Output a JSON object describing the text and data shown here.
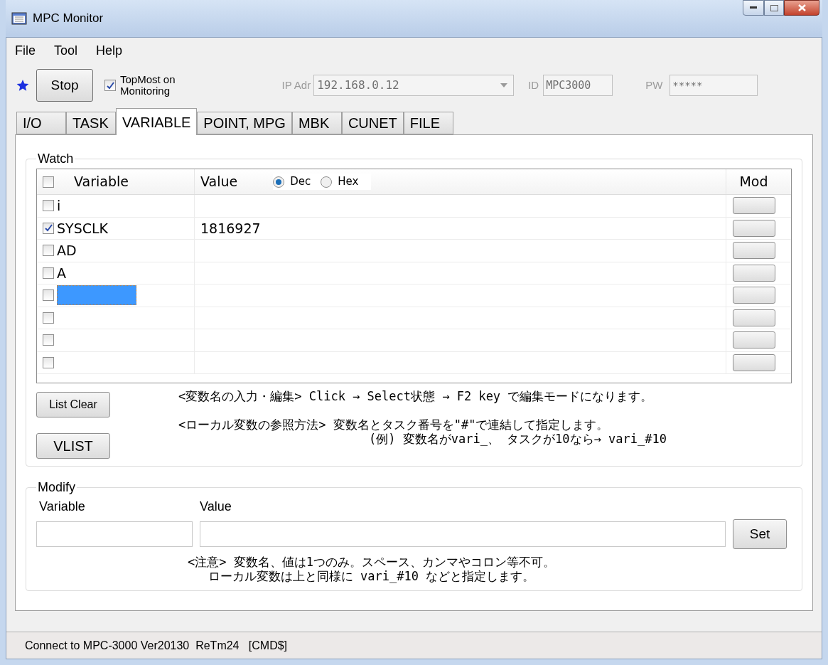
{
  "window": {
    "title": "MPC Monitor"
  },
  "menu": [
    "File",
    "Tool",
    "Help"
  ],
  "toolbar": {
    "stop_button": "Stop",
    "topmost": {
      "label_1": "TopMost on",
      "label_2": "Monitoring",
      "checked": true
    },
    "ip": {
      "label": "IP Adr",
      "value": "192.168.0.12"
    },
    "id": {
      "label": "ID",
      "value": "MPC3000"
    },
    "pw": {
      "label": "PW",
      "value": "*****"
    }
  },
  "tabs": [
    {
      "label": "I/O",
      "selected": false
    },
    {
      "label": "TASK",
      "selected": false
    },
    {
      "label": "VARIABLE",
      "selected": true
    },
    {
      "label": "POINT, MPG",
      "selected": false
    },
    {
      "label": "MBK",
      "selected": false
    },
    {
      "label": "CUNET",
      "selected": false
    },
    {
      "label": "FILE",
      "selected": false
    }
  ],
  "watch": {
    "title": "Watch",
    "columns": {
      "variable": "Variable",
      "value": "Value",
      "mod": "Mod"
    },
    "header_checked": false,
    "radix": [
      {
        "label": "Dec",
        "selected": true
      },
      {
        "label": "Hex",
        "selected": false
      }
    ],
    "rows": [
      {
        "variable": "i",
        "value": "",
        "checked": false,
        "selected": false
      },
      {
        "variable": "SYSCLK",
        "value": "1816927",
        "checked": true,
        "selected": false
      },
      {
        "variable": "AD",
        "value": "",
        "checked": false,
        "selected": false
      },
      {
        "variable": "A",
        "value": "",
        "checked": false,
        "selected": false
      },
      {
        "variable": "",
        "value": "",
        "checked": false,
        "selected": true
      },
      {
        "variable": "",
        "value": "",
        "checked": false,
        "selected": false
      },
      {
        "variable": "",
        "value": "",
        "checked": false,
        "selected": false
      },
      {
        "variable": "",
        "value": "",
        "checked": false,
        "selected": false
      }
    ],
    "buttons": [
      "List Clear",
      "VLIST"
    ],
    "notes": [
      "<変数名の入力・編集> Click → Select状態 → F2 key で編集モードになります。",
      "<ローカル変数の参照方法> 変数名とタスク番号を\"#\"で連結して指定します。",
      "(例) 変数名がvari_、 タスクが10なら→ vari_#10"
    ]
  },
  "modify": {
    "title": "Modify",
    "variable_label": "Variable",
    "value_label": "Value",
    "set_button": "Set",
    "notes": [
      "<注意> 変数名、値は1つのみ。スペース、カンマやコロン等不可。",
      "ローカル変数は上と同様に vari_#10 などと指定します。"
    ]
  },
  "status_bar": "Connect to MPC-3000 Ver20130  ReTm24   [CMD$]"
}
